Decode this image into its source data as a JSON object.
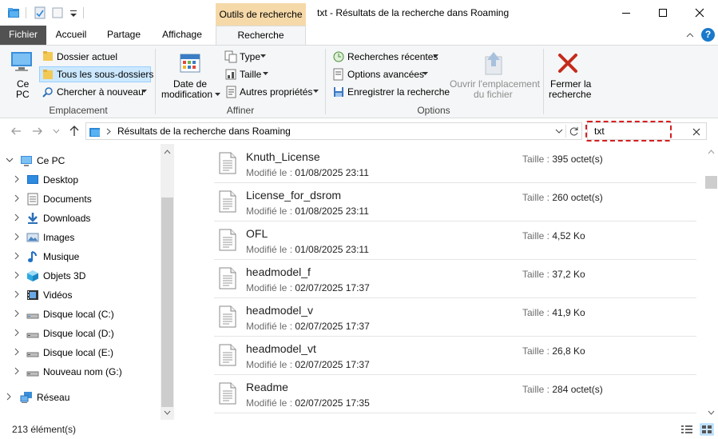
{
  "titlebar": {
    "context_tab_label": "Outils de recherche",
    "title": "txt - Résultats de la recherche dans Roaming"
  },
  "tabs": {
    "file": "Fichier",
    "home": "Accueil",
    "share": "Partage",
    "view": "Affichage",
    "search": "Recherche"
  },
  "ribbon": {
    "this_pc_line1": "Ce",
    "this_pc_line2": "PC",
    "current_folder": "Dossier actuel",
    "all_subfolders": "Tous les sous-dossiers",
    "search_again": "Chercher à nouveau",
    "location_group": "Emplacement",
    "date_modified_line1": "Date de",
    "date_modified_line2": "modification",
    "type": "Type",
    "size": "Taille",
    "other_props": "Autres propriétés",
    "refine_group": "Affiner",
    "recent_searches": "Recherches récentes",
    "advanced_options": "Options avancées",
    "save_search": "Enregistrer la recherche",
    "open_location_line1": "Ouvrir l'emplacement",
    "open_location_line2": "du fichier",
    "options_group": "Options",
    "close_search_line1": "Fermer la",
    "close_search_line2": "recherche"
  },
  "address": {
    "path": "Résultats de la recherche dans Roaming",
    "search_value": "txt"
  },
  "nav": {
    "items": [
      {
        "label": "Ce PC",
        "icon": "computer-icon"
      },
      {
        "label": "Desktop",
        "icon": "desktop-icon"
      },
      {
        "label": "Documents",
        "icon": "documents-icon"
      },
      {
        "label": "Downloads",
        "icon": "downloads-icon"
      },
      {
        "label": "Images",
        "icon": "images-icon"
      },
      {
        "label": "Musique",
        "icon": "music-icon"
      },
      {
        "label": "Objets 3D",
        "icon": "objects-3d-icon"
      },
      {
        "label": "Vidéos",
        "icon": "videos-icon"
      },
      {
        "label": "Disque local (C:)",
        "icon": "drive-icon"
      },
      {
        "label": "Disque local (D:)",
        "icon": "drive-icon"
      },
      {
        "label": "Disque local (E:)",
        "icon": "drive-icon"
      },
      {
        "label": "Nouveau nom (G:)",
        "icon": "drive-icon"
      },
      {
        "label": "Réseau",
        "icon": "network-icon"
      }
    ]
  },
  "results": {
    "modified_prefix": "Modifié le : ",
    "size_prefix": "Taille : ",
    "files": [
      {
        "name": "Knuth_License",
        "modified": "01/08/2025 23:11",
        "size": "395 octet(s)"
      },
      {
        "name": "License_for_dsrom",
        "modified": "01/08/2025 23:11",
        "size": "260 octet(s)"
      },
      {
        "name": "OFL",
        "modified": "01/08/2025 23:11",
        "size": "4,52 Ko"
      },
      {
        "name": "headmodel_f",
        "modified": "02/07/2025 17:37",
        "size": "37,2 Ko"
      },
      {
        "name": "headmodel_v",
        "modified": "02/07/2025 17:37",
        "size": "41,9 Ko"
      },
      {
        "name": "headmodel_vt",
        "modified": "02/07/2025 17:37",
        "size": "26,8 Ko"
      },
      {
        "name": "Readme",
        "modified": "02/07/2025 17:35",
        "size": "284 octet(s)"
      }
    ]
  },
  "status": {
    "count": "213 élément(s)"
  },
  "colors": {
    "accent": "#0078d7",
    "file_tab": "#525252",
    "context_tab": "#f6d9a8",
    "close_x": "#c42b1c",
    "search_highlight": "#d61f1f"
  }
}
